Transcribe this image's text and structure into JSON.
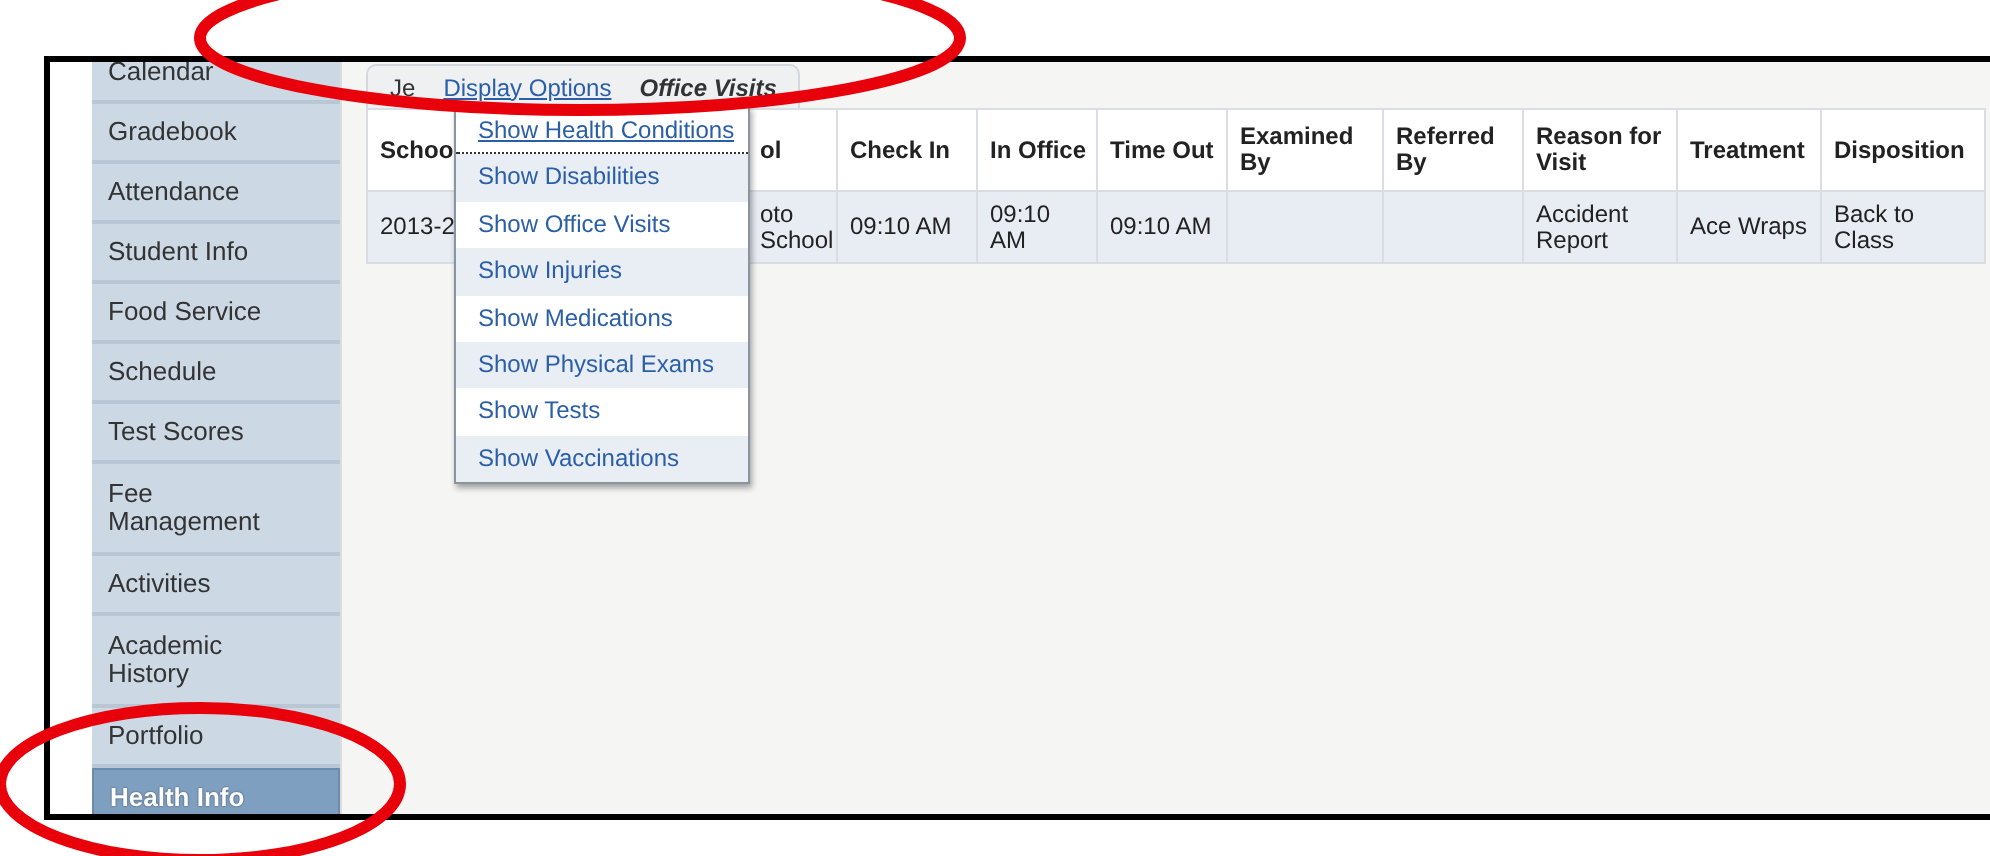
{
  "sidebar": {
    "items": [
      {
        "label": "Calendar",
        "selected": false
      },
      {
        "label": "Gradebook",
        "selected": false
      },
      {
        "label": "Attendance",
        "selected": false
      },
      {
        "label": "Student Info",
        "selected": false
      },
      {
        "label": "Food Service",
        "selected": false
      },
      {
        "label": "Schedule",
        "selected": false
      },
      {
        "label": "Test Scores",
        "selected": false
      },
      {
        "label": "Fee Management",
        "selected": false
      },
      {
        "label": "Activities",
        "selected": false
      },
      {
        "label": "Academic History",
        "selected": false
      },
      {
        "label": "Portfolio",
        "selected": false
      },
      {
        "label": "Health Info",
        "selected": true
      }
    ]
  },
  "tabs": [
    {
      "label": "Je",
      "kind": "tab",
      "selected": false
    },
    {
      "label": "Display Options",
      "kind": "link",
      "selected": false
    },
    {
      "label": "Office Visits",
      "kind": "tab",
      "selected": true
    }
  ],
  "table": {
    "columns": [
      "Schoo",
      "ol",
      "Check In",
      "In Office",
      "Time Out",
      "Examined By",
      "Referred By",
      "Reason for Visit",
      "Treatment",
      "Disposition"
    ],
    "rows": [
      [
        "2013-2",
        "oto School",
        "09:10 AM",
        "09:10 AM",
        "09:10 AM",
        "",
        "",
        "Accident Report",
        "Ace Wraps",
        "Back to Class"
      ]
    ]
  },
  "menu": {
    "items": [
      {
        "label": "Show Health Conditions",
        "selected": true
      },
      {
        "label": "Show Disabilities",
        "selected": false
      },
      {
        "label": "Show Office Visits",
        "selected": false
      },
      {
        "label": "Show Injuries",
        "selected": false
      },
      {
        "label": "Show Medications",
        "selected": false
      },
      {
        "label": "Show Physical Exams",
        "selected": false
      },
      {
        "label": "Show Tests",
        "selected": false
      },
      {
        "label": "Show Vaccinations",
        "selected": false
      }
    ]
  },
  "annotations": [
    {
      "kind": "ellipse"
    },
    {
      "kind": "ellipse"
    }
  ]
}
